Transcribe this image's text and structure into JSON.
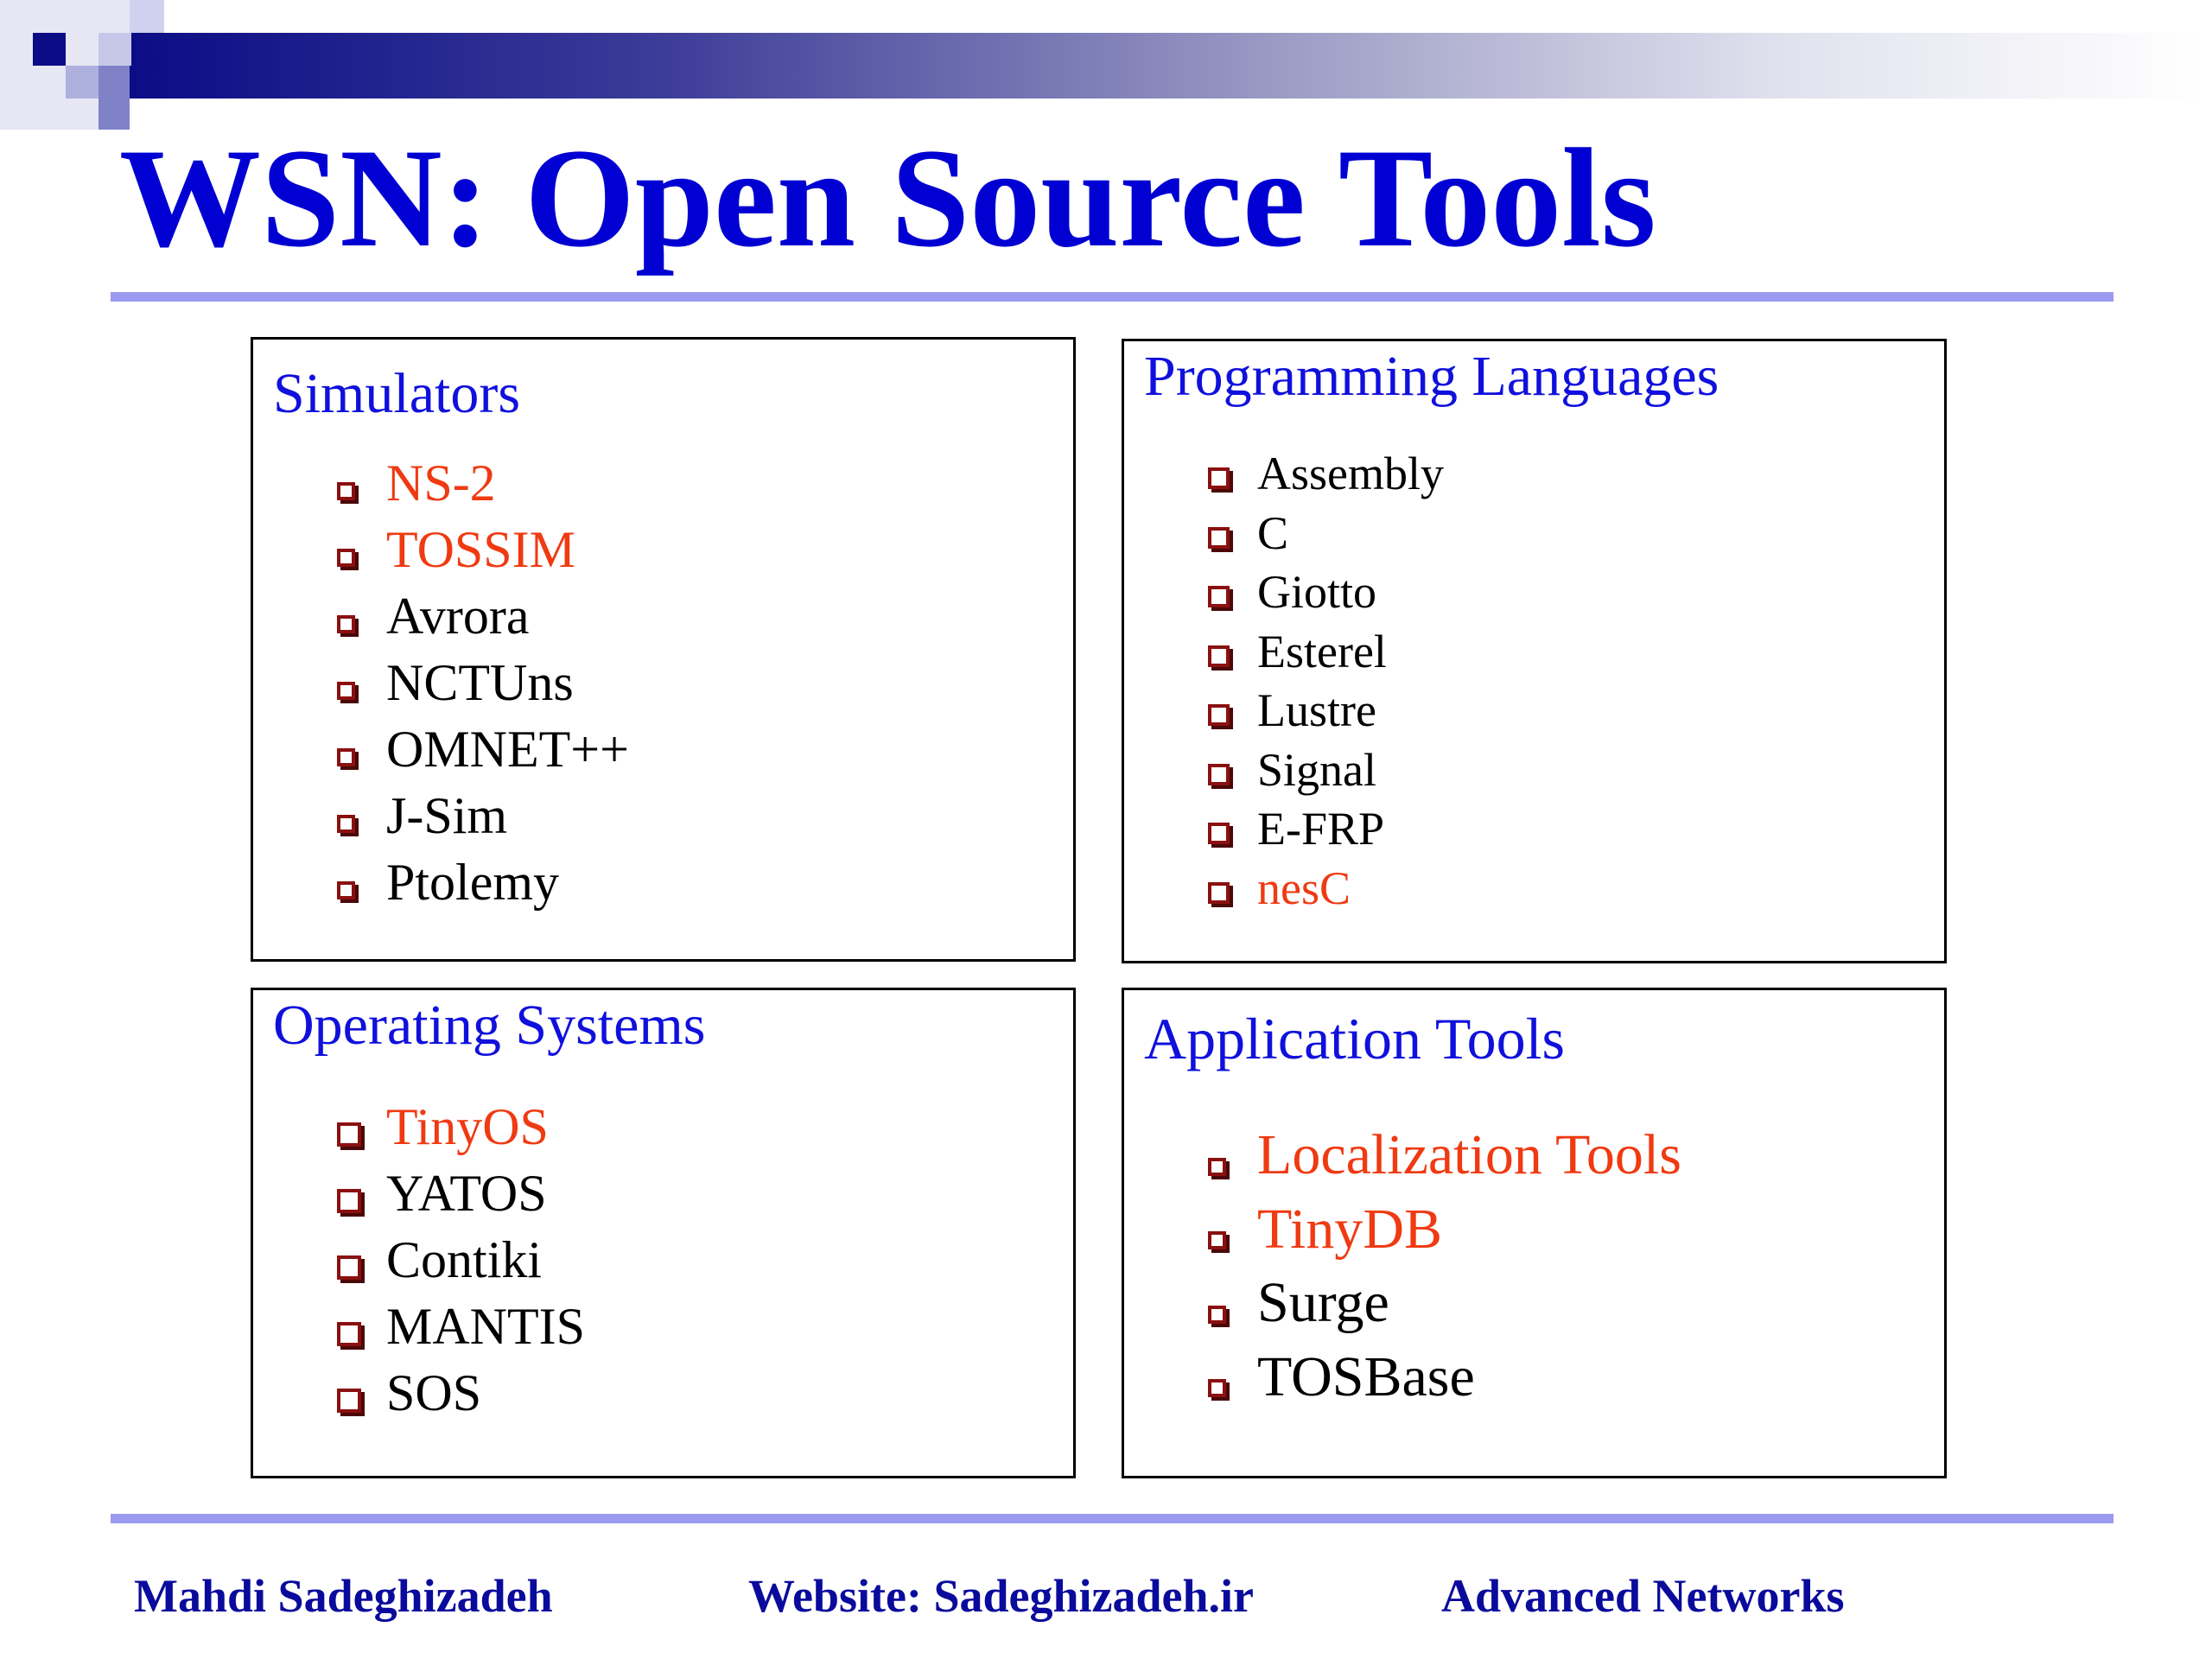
{
  "slide": {
    "title": "WSN: Open Source Tools"
  },
  "theme": {
    "title_color": "#0000d2",
    "heading_color": "#1010dd",
    "highlight_color": "#ef3a12",
    "text_color": "#000000",
    "bullet_color": "#8b1010",
    "rule_color": "#9a9af0",
    "footer_color": "#0a0a9c"
  },
  "panels": {
    "simulators": {
      "title": "Simulators",
      "bullet_icon": "hollow-square-bullet-icon",
      "items": [
        {
          "label": "NS-2",
          "highlighted": true
        },
        {
          "label": "TOSSIM",
          "highlighted": true
        },
        {
          "label": "Avrora",
          "highlighted": false
        },
        {
          "label": "NCTUns",
          "highlighted": false
        },
        {
          "label": "OMNET++",
          "highlighted": false
        },
        {
          "label": "J-Sim",
          "highlighted": false
        },
        {
          "label": "Ptolemy",
          "highlighted": false
        }
      ]
    },
    "languages": {
      "title": "Programming Languages",
      "bullet_icon": "hollow-square-bullet-icon",
      "items": [
        {
          "label": "Assembly",
          "highlighted": false
        },
        {
          "label": "C",
          "highlighted": false
        },
        {
          "label": "Giotto",
          "highlighted": false
        },
        {
          "label": "Esterel",
          "highlighted": false
        },
        {
          "label": "Lustre",
          "highlighted": false
        },
        {
          "label": "Signal",
          "highlighted": false
        },
        {
          "label": "E-FRP",
          "highlighted": false
        },
        {
          "label": "nesC",
          "highlighted": true
        }
      ]
    },
    "operating_systems": {
      "title": "Operating Systems",
      "bullet_icon": "hollow-square-bullet-icon",
      "items": [
        {
          "label": "TinyOS",
          "highlighted": true
        },
        {
          "label": "YATOS",
          "highlighted": false
        },
        {
          "label": "Contiki",
          "highlighted": false
        },
        {
          "label": "MANTIS",
          "highlighted": false
        },
        {
          "label": "SOS",
          "highlighted": false
        }
      ]
    },
    "application_tools": {
      "title": "Application Tools",
      "bullet_icon": "hollow-square-bullet-icon",
      "items": [
        {
          "label": "Localization Tools",
          "highlighted": true
        },
        {
          "label": "TinyDB",
          "highlighted": true
        },
        {
          "label": "Surge",
          "highlighted": false
        },
        {
          "label": "TOSBase",
          "highlighted": false
        }
      ]
    }
  },
  "footer": {
    "author": "Mahdi Sadeghizadeh",
    "website": "Website: Sadeghizadeh.ir",
    "course": "Advanced Networks"
  }
}
